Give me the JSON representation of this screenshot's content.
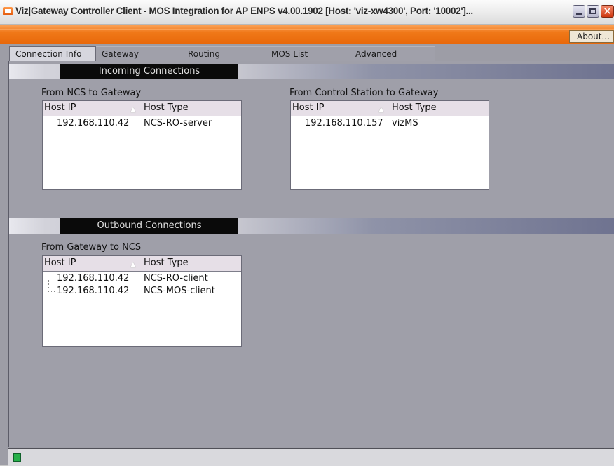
{
  "window": {
    "title": "Viz|Gateway Controller Client - MOS Integration for AP ENPS v4.00.1902    [Host: 'viz-xw4300', Port: '10002']...",
    "accent_color": "#f07818"
  },
  "menubar": {
    "about_label": "About..."
  },
  "tabs": [
    {
      "label": "Connection Info",
      "active": true
    },
    {
      "label": "Gateway",
      "active": false
    },
    {
      "label": "Routing",
      "active": false
    },
    {
      "label": "MOS List",
      "active": false
    },
    {
      "label": "Advanced",
      "active": false
    }
  ],
  "incoming": {
    "section_title": "Incoming Connections",
    "ncs_group": {
      "label": "From NCS to Gateway",
      "columns": [
        "Host IP",
        "Host Type"
      ],
      "rows": [
        {
          "ip": "192.168.110.42",
          "type": "NCS-RO-server"
        }
      ]
    },
    "control_group": {
      "label": "From Control Station to Gateway",
      "columns": [
        "Host IP",
        "Host Type"
      ],
      "rows": [
        {
          "ip": "192.168.110.157",
          "type": "vizMS"
        }
      ]
    }
  },
  "outbound": {
    "section_title": "Outbound Connections",
    "gateway_group": {
      "label": "From Gateway to NCS",
      "columns": [
        "Host IP",
        "Host Type"
      ],
      "rows": [
        {
          "ip": "192.168.110.42",
          "type": "NCS-RO-client"
        },
        {
          "ip": "192.168.110.42",
          "type": "NCS-MOS-client"
        }
      ]
    }
  },
  "icons": {
    "app": "viz-app-icon",
    "sort": "sort-ascending-icon",
    "minimize": "minimize-icon",
    "maximize": "maximize-icon",
    "close": "close-icon",
    "status": "status-led-icon"
  },
  "status": {
    "led_color": "#27b04a"
  }
}
